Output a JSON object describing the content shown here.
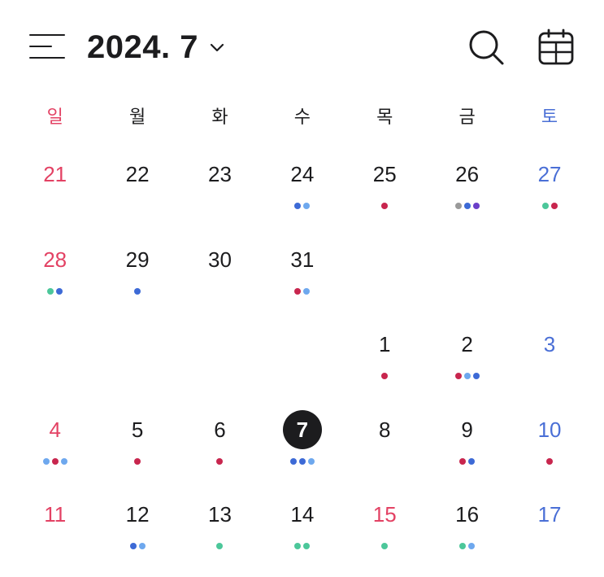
{
  "header": {
    "title": "2024. 7",
    "menu_icon": "menu-icon",
    "chevron_icon": "chevron-down-icon",
    "search_icon": "search-icon",
    "calendar_icon": "calendar-view-icon"
  },
  "colors": {
    "sunday": "#e34264",
    "saturday": "#4a6fd6",
    "today_bg": "#1c1c1e",
    "red": "#c8264e",
    "blue": "#3d6ad6",
    "lightblue": "#6ea8ee",
    "green": "#4cc79a",
    "gray": "#9a9a9a",
    "purple": "#6b3fc9"
  },
  "weekdays": [
    "일",
    "월",
    "화",
    "수",
    "목",
    "금",
    "토"
  ],
  "weeks": [
    [
      {
        "day": "21",
        "dots": []
      },
      {
        "day": "22",
        "dots": []
      },
      {
        "day": "23",
        "dots": []
      },
      {
        "day": "24",
        "dots": [
          "blue",
          "lightblue"
        ]
      },
      {
        "day": "25",
        "dots": [
          "red"
        ]
      },
      {
        "day": "26",
        "dots": [
          "gray",
          "blue",
          "purple"
        ]
      },
      {
        "day": "27",
        "dots": [
          "green",
          "red"
        ]
      }
    ],
    [
      {
        "day": "28",
        "dots": [
          "green",
          "blue"
        ]
      },
      {
        "day": "29",
        "dots": [
          "blue"
        ]
      },
      {
        "day": "30",
        "dots": []
      },
      {
        "day": "31",
        "dots": [
          "red",
          "lightblue"
        ]
      },
      null,
      null,
      null
    ],
    [
      null,
      null,
      null,
      null,
      {
        "day": "1",
        "dots": [
          "red"
        ]
      },
      {
        "day": "2",
        "dots": [
          "red",
          "lightblue",
          "blue"
        ]
      },
      {
        "day": "3",
        "dots": []
      }
    ],
    [
      {
        "day": "4",
        "dots": [
          "lightblue",
          "red",
          "lightblue"
        ]
      },
      {
        "day": "5",
        "dots": [
          "red"
        ]
      },
      {
        "day": "6",
        "dots": [
          "red"
        ]
      },
      {
        "day": "7",
        "dots": [
          "blue",
          "blue",
          "lightblue"
        ],
        "today": true
      },
      {
        "day": "8",
        "dots": []
      },
      {
        "day": "9",
        "dots": [
          "red",
          "blue"
        ]
      },
      {
        "day": "10",
        "dots": [
          "red"
        ]
      }
    ],
    [
      {
        "day": "11",
        "dots": []
      },
      {
        "day": "12",
        "dots": [
          "blue",
          "lightblue"
        ]
      },
      {
        "day": "13",
        "dots": [
          "green"
        ]
      },
      {
        "day": "14",
        "dots": [
          "green",
          "green"
        ]
      },
      {
        "day": "15",
        "dots": [
          "green"
        ],
        "holiday": true
      },
      {
        "day": "16",
        "dots": [
          "green",
          "lightblue"
        ]
      },
      {
        "day": "17",
        "dots": []
      }
    ]
  ]
}
